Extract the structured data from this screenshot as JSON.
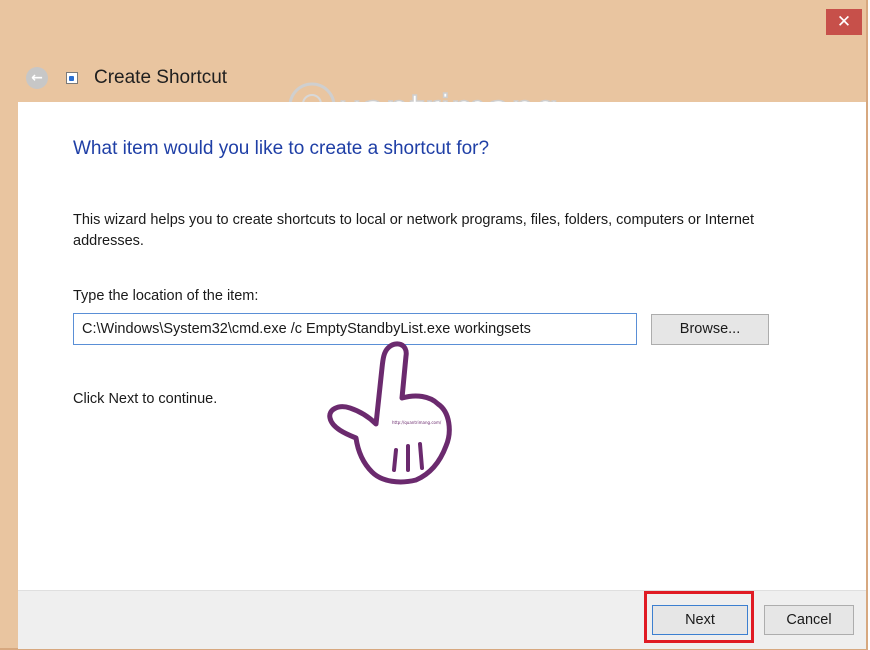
{
  "window": {
    "title": "Create Shortcut",
    "close_glyph": "✕",
    "back_glyph": "←"
  },
  "wizard": {
    "heading": "What item would you like to create a shortcut for?",
    "description": "This wizard helps you to create shortcuts to local or network programs, files, folders, computers or Internet addresses.",
    "location_label": "Type the location of the item:",
    "location_value": "C:\\Windows\\System32\\cmd.exe /c EmptyStandbyList.exe workingsets",
    "browse_label": "Browse...",
    "continue_text": "Click Next to continue."
  },
  "footer": {
    "next_label": "Next",
    "cancel_label": "Cancel"
  },
  "watermark": {
    "brand": "uantrimang",
    "hand_caption": "http://quantrimang.com/"
  },
  "colors": {
    "titlebar": "#e9c5a0",
    "close_button": "#c7504a",
    "heading_blue": "#1f3fa6",
    "highlight_red": "#e01b24",
    "hand_purple": "#6b2a6e"
  },
  "icons": {
    "back": "back-arrow-icon",
    "shortcut": "shortcut-icon",
    "close": "close-icon"
  }
}
